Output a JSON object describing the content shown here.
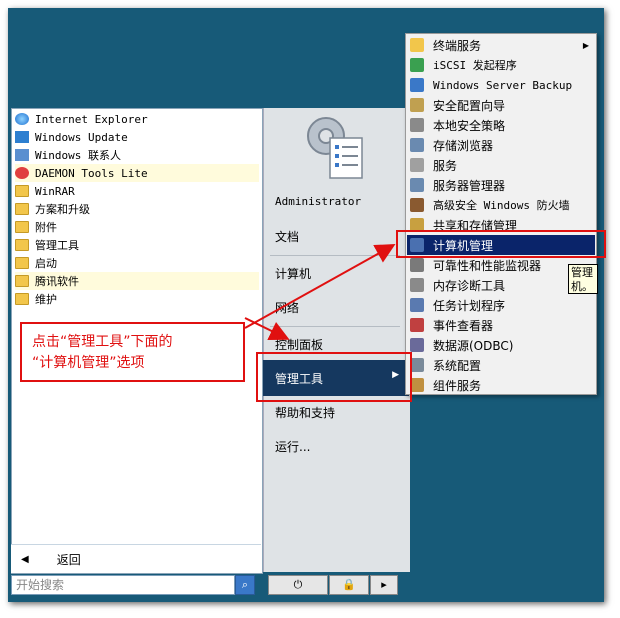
{
  "left_programs": [
    {
      "label": "Internet Explorer",
      "icon": "internet-explorer-icon",
      "highlighted": false
    },
    {
      "label": "Windows Update",
      "icon": "windows-update-icon",
      "highlighted": false
    },
    {
      "label": "Windows 联系人",
      "icon": "contacts-icon",
      "highlighted": false
    },
    {
      "label": "DAEMON Tools Lite",
      "icon": "daemon-tools-icon",
      "highlighted": true
    },
    {
      "label": "WinRAR",
      "icon": "folder-icon",
      "highlighted": false
    },
    {
      "label": "方案和升级",
      "icon": "folder-icon",
      "highlighted": false
    },
    {
      "label": "附件",
      "icon": "folder-icon",
      "highlighted": false
    },
    {
      "label": "管理工具",
      "icon": "folder-icon",
      "highlighted": false
    },
    {
      "label": "启动",
      "icon": "folder-icon",
      "highlighted": false
    },
    {
      "label": "腾讯软件",
      "icon": "folder-icon",
      "highlighted": true
    },
    {
      "label": "维护",
      "icon": "folder-icon",
      "highlighted": false
    }
  ],
  "back_label": "返回",
  "search": {
    "placeholder": "开始搜索"
  },
  "right_items": {
    "administrator": "Administrator",
    "documents": "文档",
    "computer": "计算机",
    "network": "网络",
    "control_panel": "控制面板",
    "admin_tools": "管理工具",
    "help": "帮助和支持",
    "run": "运行..."
  },
  "submenu_items": [
    {
      "label": "终端服务",
      "icon": "folder-icon",
      "has_submenu": true,
      "mono": false
    },
    {
      "label": "iSCSI 发起程序",
      "icon": "iscsi-icon",
      "has_submenu": false,
      "mono": true
    },
    {
      "label": "Windows Server Backup",
      "icon": "backup-icon",
      "has_submenu": false,
      "mono": true
    },
    {
      "label": "安全配置向导",
      "icon": "security-wizard-icon",
      "has_submenu": false,
      "mono": false
    },
    {
      "label": "本地安全策略",
      "icon": "local-policy-icon",
      "has_submenu": false,
      "mono": false
    },
    {
      "label": "存储浏览器",
      "icon": "storage-icon",
      "has_submenu": false,
      "mono": false
    },
    {
      "label": "服务",
      "icon": "services-icon",
      "has_submenu": false,
      "mono": false
    },
    {
      "label": "服务器管理器",
      "icon": "server-manager-icon",
      "has_submenu": false,
      "mono": false
    },
    {
      "label": "高级安全 Windows 防火墙",
      "icon": "firewall-icon",
      "has_submenu": false,
      "mono": true
    },
    {
      "label": "共享和存储管理",
      "icon": "share-icon",
      "has_submenu": false,
      "mono": false
    },
    {
      "label": "计算机管理",
      "icon": "computer-management-icon",
      "has_submenu": false,
      "mono": false,
      "selected": true
    },
    {
      "label": "可靠性和性能监视器",
      "icon": "monitor-icon",
      "has_submenu": false,
      "mono": false
    },
    {
      "label": "内存诊断工具",
      "icon": "memory-icon",
      "has_submenu": false,
      "mono": false
    },
    {
      "label": "任务计划程序",
      "icon": "clock-icon",
      "has_submenu": false,
      "mono": false
    },
    {
      "label": "事件查看器",
      "icon": "event-viewer-icon",
      "has_submenu": false,
      "mono": false
    },
    {
      "label": "数据源(ODBC)",
      "icon": "odbc-icon",
      "has_submenu": false,
      "mono": false
    },
    {
      "label": "系统配置",
      "icon": "system-config-icon",
      "has_submenu": false,
      "mono": false
    },
    {
      "label": "组件服务",
      "icon": "component-icon",
      "has_submenu": false,
      "mono": false
    }
  ],
  "tooltip": {
    "line1": "管理",
    "line2": "机。"
  },
  "annotation": {
    "line1": "点击“管理工具”下面的",
    "line2": "“计算机管理”选项"
  },
  "colors": {
    "annotation": "#e01010",
    "selected": "#0a246a",
    "background": "#175a78"
  }
}
